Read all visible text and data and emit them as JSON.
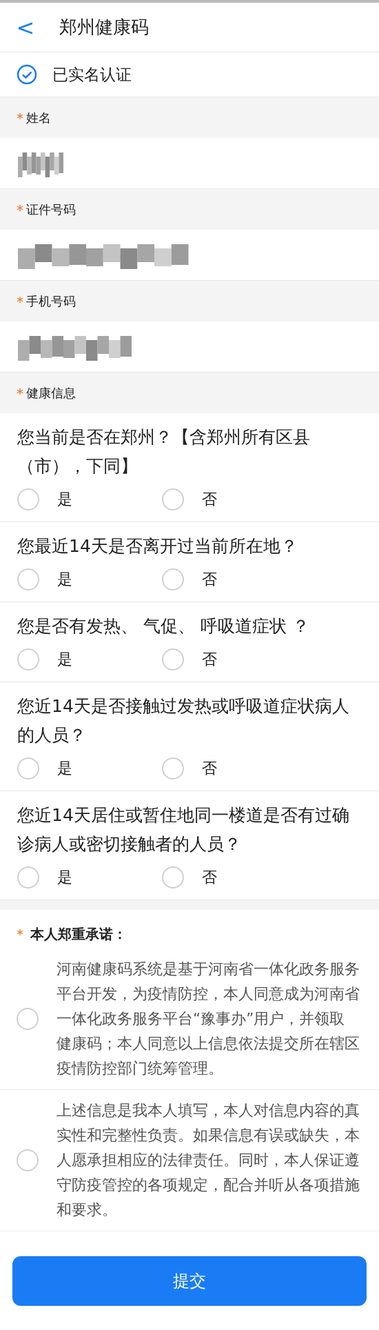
{
  "header": {
    "back": "<",
    "title": "郑州健康码"
  },
  "verified": {
    "checked": true,
    "label": "已实名认证"
  },
  "fields": [
    {
      "label": "姓名",
      "required_mark": "*",
      "kind": "blurred"
    },
    {
      "label": "证件号码",
      "required_mark": "*",
      "kind": "blurred"
    },
    {
      "label": "手机号码",
      "required_mark": "*",
      "kind": "blurred"
    }
  ],
  "health": {
    "label": "健康信息",
    "required_mark": "*"
  },
  "questions": [
    {
      "text": "您当前是否在郑州？【含郑州所有区县（市），下同】",
      "options": [
        {
          "label": "是",
          "selected": false
        },
        {
          "label": "否",
          "selected": false
        }
      ]
    },
    {
      "text": "您最近14天是否离开过当前所在地？",
      "options": [
        {
          "label": "是",
          "selected": false
        },
        {
          "label": "否",
          "selected": false
        }
      ]
    },
    {
      "text": "您是否有发热、 气促、 呼吸道症状 ？",
      "options": [
        {
          "label": "是",
          "selected": false
        },
        {
          "label": "否",
          "selected": false
        }
      ]
    },
    {
      "text": "您近14天是否接触过发热或呼吸道症状病人的人员？",
      "options": [
        {
          "label": "是",
          "selected": false
        },
        {
          "label": "否",
          "selected": false
        }
      ]
    },
    {
      "text": "您近14天居住或暂住地同一楼道是否有过确诊病人或密切接触者的人员？",
      "options": [
        {
          "label": "是",
          "selected": false
        },
        {
          "label": "否",
          "selected": false
        }
      ]
    }
  ],
  "pledge": {
    "title": "本人郑重承诺：",
    "required_mark": "*",
    "items": [
      {
        "text": "河南健康码系统是基于河南省一体化政务服务平台开发，为疫情防控，本人同意成为河南省一体化政务服务平台“豫事办”用户，并领取健康码；本人同意以上信息依法提交所在辖区疫情防控部门统筹管理。",
        "checked": false
      },
      {
        "text": "上述信息是我本人填写，本人对信息内容的真实性和完整性负责。如果信息有误或缺失，本人愿承担相应的法律责任。同时，本人保证遵守防疫管控的各项规定，配合并听从各项措施和要求。",
        "checked": false
      }
    ]
  },
  "submit": "提交"
}
